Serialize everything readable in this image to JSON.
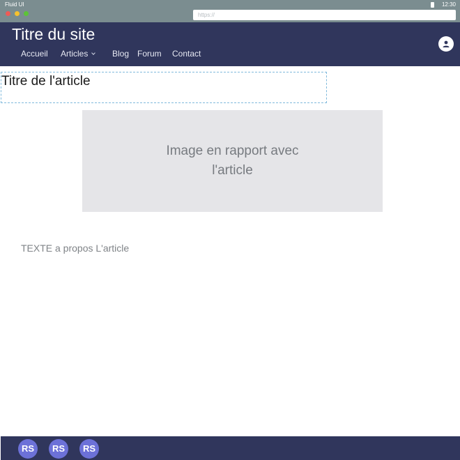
{
  "system_bar": {
    "app_name": "Fluid UI",
    "time": "12:30",
    "url_placeholder": "https://"
  },
  "header": {
    "site_title": "Titre du site",
    "nav": [
      {
        "label": "Accueil"
      },
      {
        "label": "Articles"
      },
      {
        "label": "Blog"
      },
      {
        "label": "Forum"
      },
      {
        "label": "Contact"
      }
    ]
  },
  "article": {
    "title": "Titre de l'article",
    "image_placeholder": "Image en rapport avec l'article",
    "text": "TEXTE a propos L'article"
  },
  "footer": {
    "social": [
      {
        "label": "RS"
      },
      {
        "label": "RS"
      },
      {
        "label": "RS"
      }
    ]
  },
  "colors": {
    "chrome": "#7b8d90",
    "header_bg": "#30365c",
    "social_button": "#6c71d8",
    "image_bg": "#e5e5e8"
  },
  "icons": {
    "user": "user-icon",
    "dropdown": "chevron-down-icon",
    "battery": "battery-icon"
  }
}
